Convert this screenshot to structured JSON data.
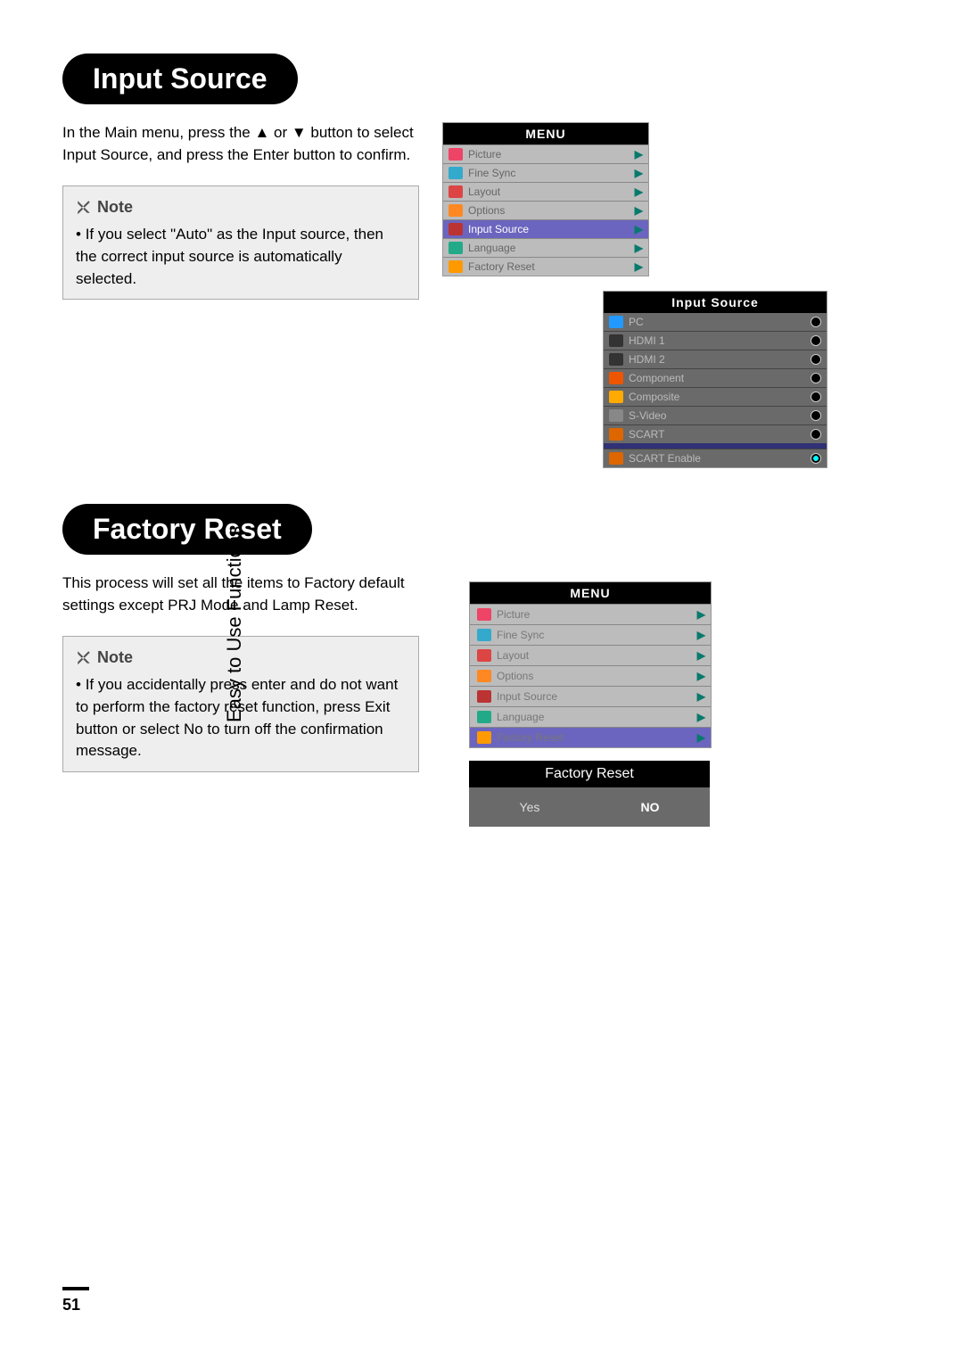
{
  "sideTab": "Easy to Use Functions",
  "pageNum": "51",
  "s1": {
    "heading": "Input Source",
    "intro": "In the Main menu, press the ▲ or ▼ button to select Input Source, and press the Enter button to confirm.",
    "noteTitle": "Note",
    "noteBody": "If you select \"Auto\" as the Input source, then the correct input source is automatically selected."
  },
  "s2": {
    "heading": "Factory Reset",
    "intro": "This process will set all the items to Factory default settings except PRJ Mode and Lamp Reset.",
    "noteTitle": "Note",
    "noteBody": "If you accidentally press enter and do not want to perform the factory reset function, press Exit button or select No to turn off the confirmation message."
  },
  "menuTitle": "MENU",
  "menuItems": {
    "picture": "Picture",
    "fineSync": "Fine Sync",
    "layout": "Layout",
    "options": "Options",
    "inputSource": "Input Source",
    "language": "Language",
    "factoryReset": "Factory Reset"
  },
  "inputTitle": "Input Source",
  "inputs": {
    "pc": "PC",
    "hdmi1": "HDMI 1",
    "hdmi2": "HDMI 2",
    "component": "Component",
    "composite": "Composite",
    "svideo": "S-Video",
    "scart": "SCART",
    "scartEnable": "SCART Enable"
  },
  "frTitle": "Factory Reset",
  "frYes": "Yes",
  "frNo": "NO"
}
